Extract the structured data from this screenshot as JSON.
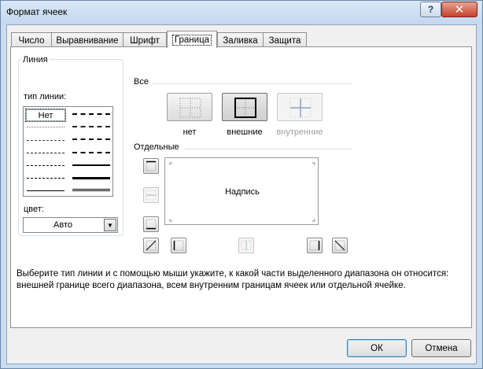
{
  "window": {
    "title": "Формат ячеек",
    "help_label": "?",
    "close_label": "✕"
  },
  "tabs": [
    {
      "label": "Число",
      "active": false
    },
    {
      "label": "Выравнивание",
      "active": false
    },
    {
      "label": "Шрифт",
      "active": false
    },
    {
      "label": "Граница",
      "active": true
    },
    {
      "label": "Заливка",
      "active": false
    },
    {
      "label": "Защита",
      "active": false
    }
  ],
  "line_group": {
    "title": "Линия",
    "type_label": "тип линии:",
    "none_label": "Нет",
    "color_label": "цвет:",
    "color_value": "Авто",
    "color_dropdown_icon": "chevron-down-icon"
  },
  "presets": {
    "title": "Все",
    "items": [
      {
        "label": "нет",
        "enabled": true
      },
      {
        "label": "внешние",
        "enabled": true
      },
      {
        "label": "внутренние",
        "enabled": false
      }
    ]
  },
  "individual": {
    "title": "Отдельные",
    "preview_text": "Надпись"
  },
  "description": "Выберите тип линии и с помощью мыши укажите, к какой части выделенного диапазона он относится: внешней границе всего диапазона, всем внутренним границам ячеек или отдельной ячейке.",
  "buttons": {
    "ok": "ОК",
    "cancel": "Отмена"
  },
  "colors": {
    "title_bar": "#c9dcf0",
    "close_button": "#c4422a",
    "panel": "#ffffff",
    "dialog": "#f0f0f0"
  }
}
